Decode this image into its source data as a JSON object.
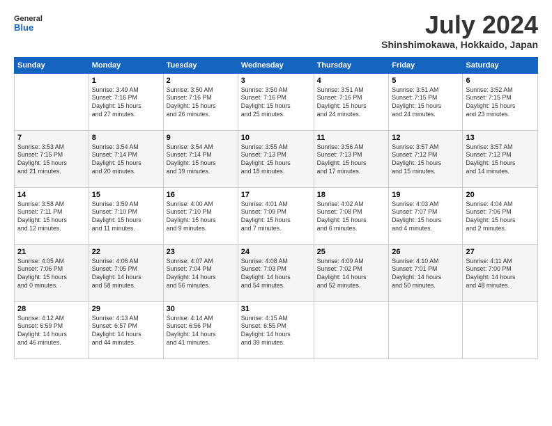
{
  "header": {
    "logo_line1": "General",
    "logo_line2": "Blue",
    "month_title": "July 2024",
    "location": "Shinshimokawa, Hokkaido, Japan"
  },
  "weekdays": [
    "Sunday",
    "Monday",
    "Tuesday",
    "Wednesday",
    "Thursday",
    "Friday",
    "Saturday"
  ],
  "weeks": [
    [
      {
        "day": "",
        "info": ""
      },
      {
        "day": "1",
        "info": "Sunrise: 3:49 AM\nSunset: 7:16 PM\nDaylight: 15 hours\nand 27 minutes."
      },
      {
        "day": "2",
        "info": "Sunrise: 3:50 AM\nSunset: 7:16 PM\nDaylight: 15 hours\nand 26 minutes."
      },
      {
        "day": "3",
        "info": "Sunrise: 3:50 AM\nSunset: 7:16 PM\nDaylight: 15 hours\nand 25 minutes."
      },
      {
        "day": "4",
        "info": "Sunrise: 3:51 AM\nSunset: 7:16 PM\nDaylight: 15 hours\nand 24 minutes."
      },
      {
        "day": "5",
        "info": "Sunrise: 3:51 AM\nSunset: 7:15 PM\nDaylight: 15 hours\nand 24 minutes."
      },
      {
        "day": "6",
        "info": "Sunrise: 3:52 AM\nSunset: 7:15 PM\nDaylight: 15 hours\nand 23 minutes."
      }
    ],
    [
      {
        "day": "7",
        "info": "Sunrise: 3:53 AM\nSunset: 7:15 PM\nDaylight: 15 hours\nand 21 minutes."
      },
      {
        "day": "8",
        "info": "Sunrise: 3:54 AM\nSunset: 7:14 PM\nDaylight: 15 hours\nand 20 minutes."
      },
      {
        "day": "9",
        "info": "Sunrise: 3:54 AM\nSunset: 7:14 PM\nDaylight: 15 hours\nand 19 minutes."
      },
      {
        "day": "10",
        "info": "Sunrise: 3:55 AM\nSunset: 7:13 PM\nDaylight: 15 hours\nand 18 minutes."
      },
      {
        "day": "11",
        "info": "Sunrise: 3:56 AM\nSunset: 7:13 PM\nDaylight: 15 hours\nand 17 minutes."
      },
      {
        "day": "12",
        "info": "Sunrise: 3:57 AM\nSunset: 7:12 PM\nDaylight: 15 hours\nand 15 minutes."
      },
      {
        "day": "13",
        "info": "Sunrise: 3:57 AM\nSunset: 7:12 PM\nDaylight: 15 hours\nand 14 minutes."
      }
    ],
    [
      {
        "day": "14",
        "info": "Sunrise: 3:58 AM\nSunset: 7:11 PM\nDaylight: 15 hours\nand 12 minutes."
      },
      {
        "day": "15",
        "info": "Sunrise: 3:59 AM\nSunset: 7:10 PM\nDaylight: 15 hours\nand 11 minutes."
      },
      {
        "day": "16",
        "info": "Sunrise: 4:00 AM\nSunset: 7:10 PM\nDaylight: 15 hours\nand 9 minutes."
      },
      {
        "day": "17",
        "info": "Sunrise: 4:01 AM\nSunset: 7:09 PM\nDaylight: 15 hours\nand 7 minutes."
      },
      {
        "day": "18",
        "info": "Sunrise: 4:02 AM\nSunset: 7:08 PM\nDaylight: 15 hours\nand 6 minutes."
      },
      {
        "day": "19",
        "info": "Sunrise: 4:03 AM\nSunset: 7:07 PM\nDaylight: 15 hours\nand 4 minutes."
      },
      {
        "day": "20",
        "info": "Sunrise: 4:04 AM\nSunset: 7:06 PM\nDaylight: 15 hours\nand 2 minutes."
      }
    ],
    [
      {
        "day": "21",
        "info": "Sunrise: 4:05 AM\nSunset: 7:06 PM\nDaylight: 15 hours\nand 0 minutes."
      },
      {
        "day": "22",
        "info": "Sunrise: 4:06 AM\nSunset: 7:05 PM\nDaylight: 14 hours\nand 58 minutes."
      },
      {
        "day": "23",
        "info": "Sunrise: 4:07 AM\nSunset: 7:04 PM\nDaylight: 14 hours\nand 56 minutes."
      },
      {
        "day": "24",
        "info": "Sunrise: 4:08 AM\nSunset: 7:03 PM\nDaylight: 14 hours\nand 54 minutes."
      },
      {
        "day": "25",
        "info": "Sunrise: 4:09 AM\nSunset: 7:02 PM\nDaylight: 14 hours\nand 52 minutes."
      },
      {
        "day": "26",
        "info": "Sunrise: 4:10 AM\nSunset: 7:01 PM\nDaylight: 14 hours\nand 50 minutes."
      },
      {
        "day": "27",
        "info": "Sunrise: 4:11 AM\nSunset: 7:00 PM\nDaylight: 14 hours\nand 48 minutes."
      }
    ],
    [
      {
        "day": "28",
        "info": "Sunrise: 4:12 AM\nSunset: 6:59 PM\nDaylight: 14 hours\nand 46 minutes."
      },
      {
        "day": "29",
        "info": "Sunrise: 4:13 AM\nSunset: 6:57 PM\nDaylight: 14 hours\nand 44 minutes."
      },
      {
        "day": "30",
        "info": "Sunrise: 4:14 AM\nSunset: 6:56 PM\nDaylight: 14 hours\nand 41 minutes."
      },
      {
        "day": "31",
        "info": "Sunrise: 4:15 AM\nSunset: 6:55 PM\nDaylight: 14 hours\nand 39 minutes."
      },
      {
        "day": "",
        "info": ""
      },
      {
        "day": "",
        "info": ""
      },
      {
        "day": "",
        "info": ""
      }
    ]
  ]
}
